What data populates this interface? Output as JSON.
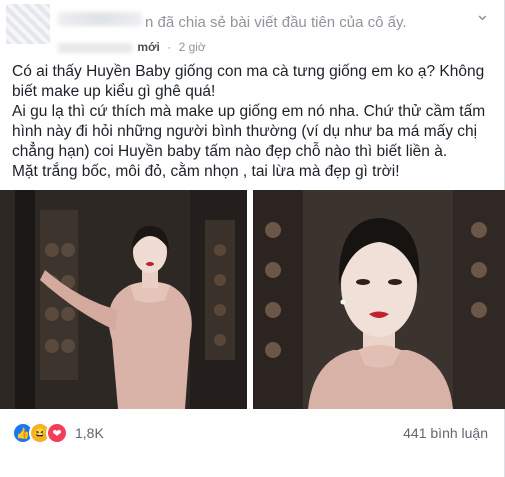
{
  "header": {
    "line": "n đã chia sẻ bài viết đầu tiên của cô ấy.",
    "badge": "mới",
    "time": "2 giờ"
  },
  "post": {
    "lines": [
      "Có ai thấy Huyền Baby giống con ma cà tưng giống em ko ạ? Không biết make up kiểu gì ghê quá!",
      "Ai gu lạ thì cứ thích mà make up giống em nó nha. Chứ thử cầm tấm hình này đi hỏi những người bình thường (ví dụ như ba má mấy chị chẳng hạn) coi Huyền baby tấm nào đẹp chỗ nào thì biết liền à.",
      "Mặt trắng bốc, môi đỏ, cằm nhọn , tai lừa mà đẹp gì trời!"
    ]
  },
  "footer": {
    "reaction_count": "1,8K",
    "comments": "441 bình luận"
  },
  "colors": {
    "like": "#1877f2",
    "love": "#f33e58",
    "haha": "#f7b125"
  }
}
